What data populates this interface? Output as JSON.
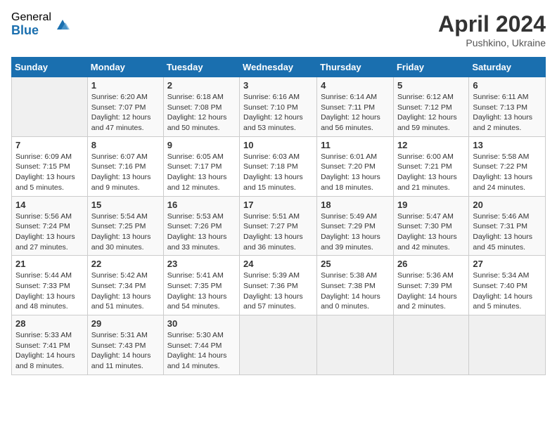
{
  "header": {
    "logo_general": "General",
    "logo_blue": "Blue",
    "month_year": "April 2024",
    "location": "Pushkino, Ukraine"
  },
  "days_of_week": [
    "Sunday",
    "Monday",
    "Tuesday",
    "Wednesday",
    "Thursday",
    "Friday",
    "Saturday"
  ],
  "weeks": [
    [
      {
        "num": "",
        "info": ""
      },
      {
        "num": "1",
        "info": "Sunrise: 6:20 AM\nSunset: 7:07 PM\nDaylight: 12 hours\nand 47 minutes."
      },
      {
        "num": "2",
        "info": "Sunrise: 6:18 AM\nSunset: 7:08 PM\nDaylight: 12 hours\nand 50 minutes."
      },
      {
        "num": "3",
        "info": "Sunrise: 6:16 AM\nSunset: 7:10 PM\nDaylight: 12 hours\nand 53 minutes."
      },
      {
        "num": "4",
        "info": "Sunrise: 6:14 AM\nSunset: 7:11 PM\nDaylight: 12 hours\nand 56 minutes."
      },
      {
        "num": "5",
        "info": "Sunrise: 6:12 AM\nSunset: 7:12 PM\nDaylight: 12 hours\nand 59 minutes."
      },
      {
        "num": "6",
        "info": "Sunrise: 6:11 AM\nSunset: 7:13 PM\nDaylight: 13 hours\nand 2 minutes."
      }
    ],
    [
      {
        "num": "7",
        "info": "Sunrise: 6:09 AM\nSunset: 7:15 PM\nDaylight: 13 hours\nand 5 minutes."
      },
      {
        "num": "8",
        "info": "Sunrise: 6:07 AM\nSunset: 7:16 PM\nDaylight: 13 hours\nand 9 minutes."
      },
      {
        "num": "9",
        "info": "Sunrise: 6:05 AM\nSunset: 7:17 PM\nDaylight: 13 hours\nand 12 minutes."
      },
      {
        "num": "10",
        "info": "Sunrise: 6:03 AM\nSunset: 7:18 PM\nDaylight: 13 hours\nand 15 minutes."
      },
      {
        "num": "11",
        "info": "Sunrise: 6:01 AM\nSunset: 7:20 PM\nDaylight: 13 hours\nand 18 minutes."
      },
      {
        "num": "12",
        "info": "Sunrise: 6:00 AM\nSunset: 7:21 PM\nDaylight: 13 hours\nand 21 minutes."
      },
      {
        "num": "13",
        "info": "Sunrise: 5:58 AM\nSunset: 7:22 PM\nDaylight: 13 hours\nand 24 minutes."
      }
    ],
    [
      {
        "num": "14",
        "info": "Sunrise: 5:56 AM\nSunset: 7:24 PM\nDaylight: 13 hours\nand 27 minutes."
      },
      {
        "num": "15",
        "info": "Sunrise: 5:54 AM\nSunset: 7:25 PM\nDaylight: 13 hours\nand 30 minutes."
      },
      {
        "num": "16",
        "info": "Sunrise: 5:53 AM\nSunset: 7:26 PM\nDaylight: 13 hours\nand 33 minutes."
      },
      {
        "num": "17",
        "info": "Sunrise: 5:51 AM\nSunset: 7:27 PM\nDaylight: 13 hours\nand 36 minutes."
      },
      {
        "num": "18",
        "info": "Sunrise: 5:49 AM\nSunset: 7:29 PM\nDaylight: 13 hours\nand 39 minutes."
      },
      {
        "num": "19",
        "info": "Sunrise: 5:47 AM\nSunset: 7:30 PM\nDaylight: 13 hours\nand 42 minutes."
      },
      {
        "num": "20",
        "info": "Sunrise: 5:46 AM\nSunset: 7:31 PM\nDaylight: 13 hours\nand 45 minutes."
      }
    ],
    [
      {
        "num": "21",
        "info": "Sunrise: 5:44 AM\nSunset: 7:33 PM\nDaylight: 13 hours\nand 48 minutes."
      },
      {
        "num": "22",
        "info": "Sunrise: 5:42 AM\nSunset: 7:34 PM\nDaylight: 13 hours\nand 51 minutes."
      },
      {
        "num": "23",
        "info": "Sunrise: 5:41 AM\nSunset: 7:35 PM\nDaylight: 13 hours\nand 54 minutes."
      },
      {
        "num": "24",
        "info": "Sunrise: 5:39 AM\nSunset: 7:36 PM\nDaylight: 13 hours\nand 57 minutes."
      },
      {
        "num": "25",
        "info": "Sunrise: 5:38 AM\nSunset: 7:38 PM\nDaylight: 14 hours\nand 0 minutes."
      },
      {
        "num": "26",
        "info": "Sunrise: 5:36 AM\nSunset: 7:39 PM\nDaylight: 14 hours\nand 2 minutes."
      },
      {
        "num": "27",
        "info": "Sunrise: 5:34 AM\nSunset: 7:40 PM\nDaylight: 14 hours\nand 5 minutes."
      }
    ],
    [
      {
        "num": "28",
        "info": "Sunrise: 5:33 AM\nSunset: 7:41 PM\nDaylight: 14 hours\nand 8 minutes."
      },
      {
        "num": "29",
        "info": "Sunrise: 5:31 AM\nSunset: 7:43 PM\nDaylight: 14 hours\nand 11 minutes."
      },
      {
        "num": "30",
        "info": "Sunrise: 5:30 AM\nSunset: 7:44 PM\nDaylight: 14 hours\nand 14 minutes."
      },
      {
        "num": "",
        "info": ""
      },
      {
        "num": "",
        "info": ""
      },
      {
        "num": "",
        "info": ""
      },
      {
        "num": "",
        "info": ""
      }
    ]
  ]
}
